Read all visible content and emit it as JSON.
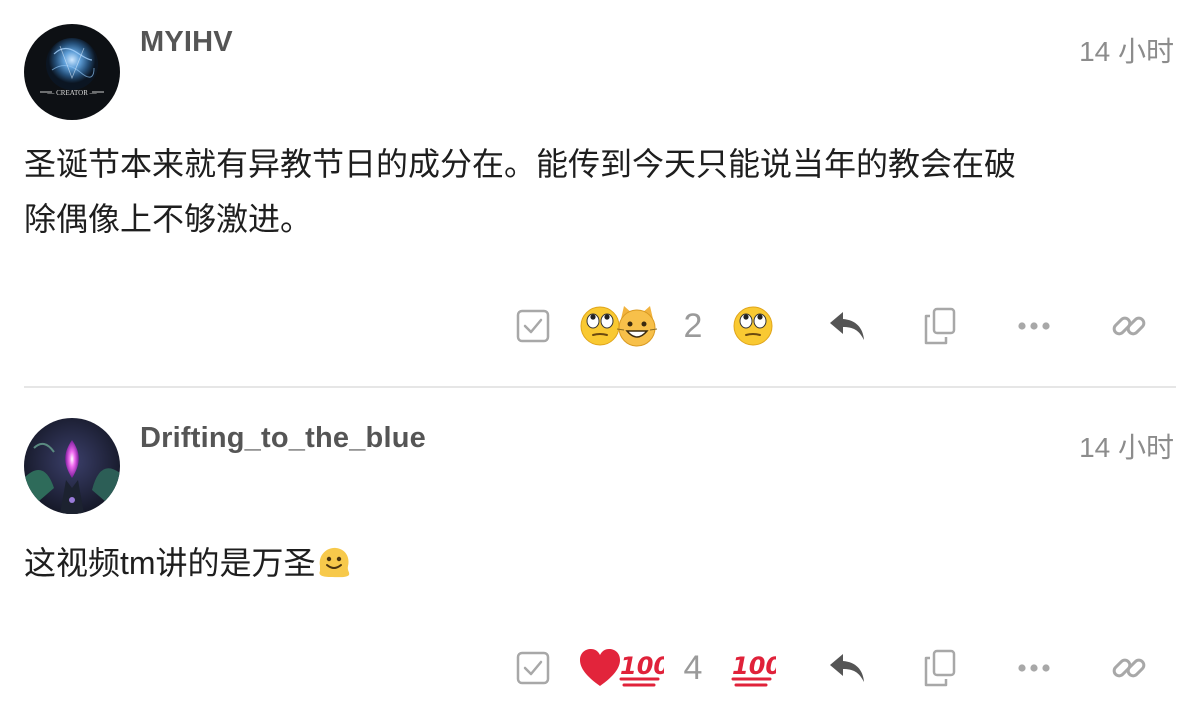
{
  "posts": [
    {
      "username": "MYIHV",
      "time": "14 小时",
      "avatar_label": "— CREATOR —",
      "body_lines": [
        "圣诞节本来就有异教节日的成分在。能传到今天只能说当年的教会在破",
        "除偶像上不够激进。"
      ],
      "reactions": [
        "face-with-rolling-eyes-emoji",
        "grinning-cat-emoji"
      ],
      "reaction_count": "2",
      "my_reaction": "face-with-rolling-eyes-emoji"
    },
    {
      "username": "Drifting_to_the_blue",
      "time": "14 小时",
      "body_text": "这视频tm讲的是万圣",
      "body_emoji": "melting-face-emoji",
      "reactions": [
        "red-heart-emoji",
        "hundred-points-emoji"
      ],
      "reaction_count": "4",
      "my_reaction": "hundred-points-emoji"
    }
  ],
  "colors": {
    "icon_gray": "#9a9a9a",
    "icon_dark": "#555555",
    "divider": "#e6e6e6"
  }
}
